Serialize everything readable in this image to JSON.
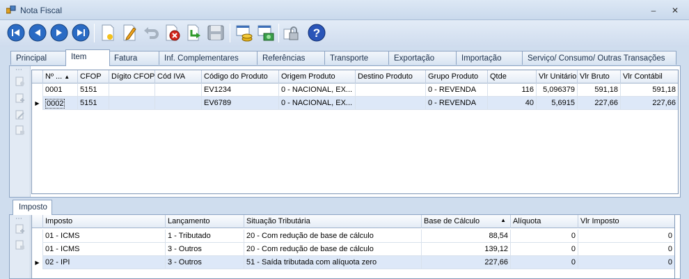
{
  "window": {
    "title": "Nota Fiscal",
    "minimize": "–",
    "close": "✕"
  },
  "toolbar": {
    "buttons": [
      "first-record",
      "previous-record",
      "next-record",
      "last-record",
      "new-record",
      "edit-record",
      "undo",
      "delete-record",
      "save-arrow",
      "save-disk",
      "coins-report",
      "money-report",
      "lock",
      "help"
    ]
  },
  "tabs": [
    "Principal",
    "Item",
    "Fatura",
    "Inf. Complementares",
    "Referências",
    "Transporte",
    "Exportação",
    "Importação",
    "Serviço/ Consumo/ Outras Transações"
  ],
  "items_grid": {
    "columns": [
      "Nº ...",
      "CFOP",
      "Dígito CFOP",
      "Cód IVA",
      "Código do Produto",
      "Origem Produto",
      "Destino Produto",
      "Grupo Produto",
      "Qtde",
      "Vlr Unitário",
      "Vlr Bruto",
      "Vlr Contábil"
    ],
    "sort_indicator": "▲",
    "rows": [
      {
        "num": "0001",
        "cfop": "5151",
        "digito": "",
        "iva": "",
        "codigo": "EV1234",
        "origem": "0 - NACIONAL, EX...",
        "destino": "",
        "grupo": "0 - REVENDA",
        "qtde": "116",
        "unit": "5,096379",
        "bruto": "591,18",
        "contabil": "591,18"
      },
      {
        "num": "0002",
        "cfop": "5151",
        "digito": "",
        "iva": "",
        "codigo": "EV6789",
        "origem": "0 - NACIONAL, EX...",
        "destino": "",
        "grupo": "0 - REVENDA",
        "qtde": "40",
        "unit": "5,6915",
        "bruto": "227,66",
        "contabil": "227,66"
      }
    ]
  },
  "tax_tab": {
    "label": "Imposto"
  },
  "tax_grid": {
    "columns": [
      "Imposto",
      "Lançamento",
      "Situação Tributária",
      "Base de Cálculo",
      "Alíquota",
      "Vlr Imposto"
    ],
    "sort_indicator": "▲",
    "rows": [
      {
        "imposto": "01 - ICMS",
        "lanc": "1 - Tributado",
        "situacao": "20 - Com redução de base de cálculo",
        "base": "88,54",
        "aliq": "0",
        "valor": "0"
      },
      {
        "imposto": "01 - ICMS",
        "lanc": "3 - Outros",
        "situacao": "20 - Com redução de base de cálculo",
        "base": "139,12",
        "aliq": "0",
        "valor": "0"
      },
      {
        "imposto": "02 - IPI",
        "lanc": "3 - Outros",
        "situacao": "51 - Saída tributada com alíquota zero",
        "base": "227,66",
        "aliq": "0",
        "valor": "0"
      }
    ]
  },
  "indicators": {
    "current_row": "▶",
    "sidebar_dots": "⋯"
  }
}
